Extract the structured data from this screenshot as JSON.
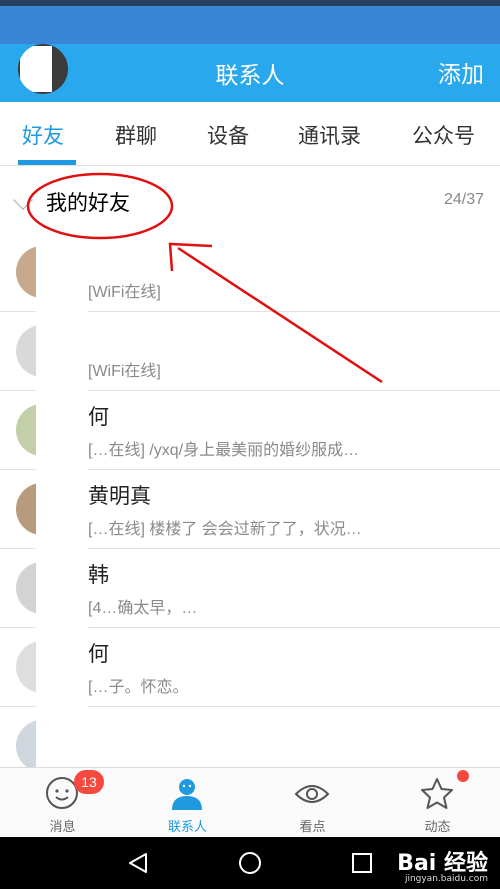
{
  "header": {
    "title": "联系人",
    "add_label": "添加"
  },
  "tabs": [
    {
      "label": "好友",
      "active": true
    },
    {
      "label": "群聊",
      "active": false
    },
    {
      "label": "设备",
      "active": false
    },
    {
      "label": "通讯录",
      "active": false
    },
    {
      "label": "公众号",
      "active": false
    }
  ],
  "group": {
    "name": "我的好友",
    "count": "24/37"
  },
  "friends": [
    {
      "name": "",
      "status": "[WiFi在线]"
    },
    {
      "name": "",
      "status": "[WiFi在线]"
    },
    {
      "name": "何",
      "status": "[…在线] /yxq/身上最美丽的婚纱服成…"
    },
    {
      "name": "黄明真",
      "status": "[…在线] 楼楼了 会会过新了了，状况…"
    },
    {
      "name": "韩",
      "status": "[4…确太早，…"
    },
    {
      "name": "何",
      "status": "[…子。怀恋。"
    },
    {
      "name": "",
      "status": ""
    }
  ],
  "bottom_nav": [
    {
      "label": "消息",
      "icon": "chat-bubble-icon",
      "badge": "13",
      "active": false
    },
    {
      "label": "联系人",
      "icon": "person-icon",
      "badge": "",
      "active": true
    },
    {
      "label": "看点",
      "icon": "eye-icon",
      "badge": "",
      "active": false
    },
    {
      "label": "动态",
      "icon": "star-icon",
      "badge": "dot",
      "active": false
    }
  ],
  "system_nav": {
    "back": "back-icon",
    "home": "home-icon",
    "recent": "recent-apps-icon"
  },
  "watermark": {
    "text": "Bai 经验",
    "sub": "jingyan.baidu.com"
  },
  "colors": {
    "accent": "#2aa8ee",
    "active": "#1f9ae0",
    "badge": "#f5483e",
    "annotation": "#e01010"
  }
}
